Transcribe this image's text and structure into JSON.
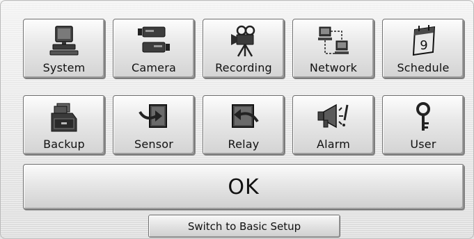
{
  "menu": {
    "row1": [
      {
        "label": "System",
        "icon": "computer-icon"
      },
      {
        "label": "Camera",
        "icon": "camera-icon"
      },
      {
        "label": "Recording",
        "icon": "film-camera-icon"
      },
      {
        "label": "Network",
        "icon": "network-icon"
      },
      {
        "label": "Schedule",
        "icon": "calendar-icon"
      }
    ],
    "row2": [
      {
        "label": "Backup",
        "icon": "file-cabinet-icon"
      },
      {
        "label": "Sensor",
        "icon": "sensor-in-icon"
      },
      {
        "label": "Relay",
        "icon": "relay-out-icon"
      },
      {
        "label": "Alarm",
        "icon": "megaphone-icon"
      },
      {
        "label": "User",
        "icon": "key-icon"
      }
    ]
  },
  "ok_label": "OK",
  "basic_setup_label": "Switch to Basic Setup",
  "calendar_day": "9"
}
